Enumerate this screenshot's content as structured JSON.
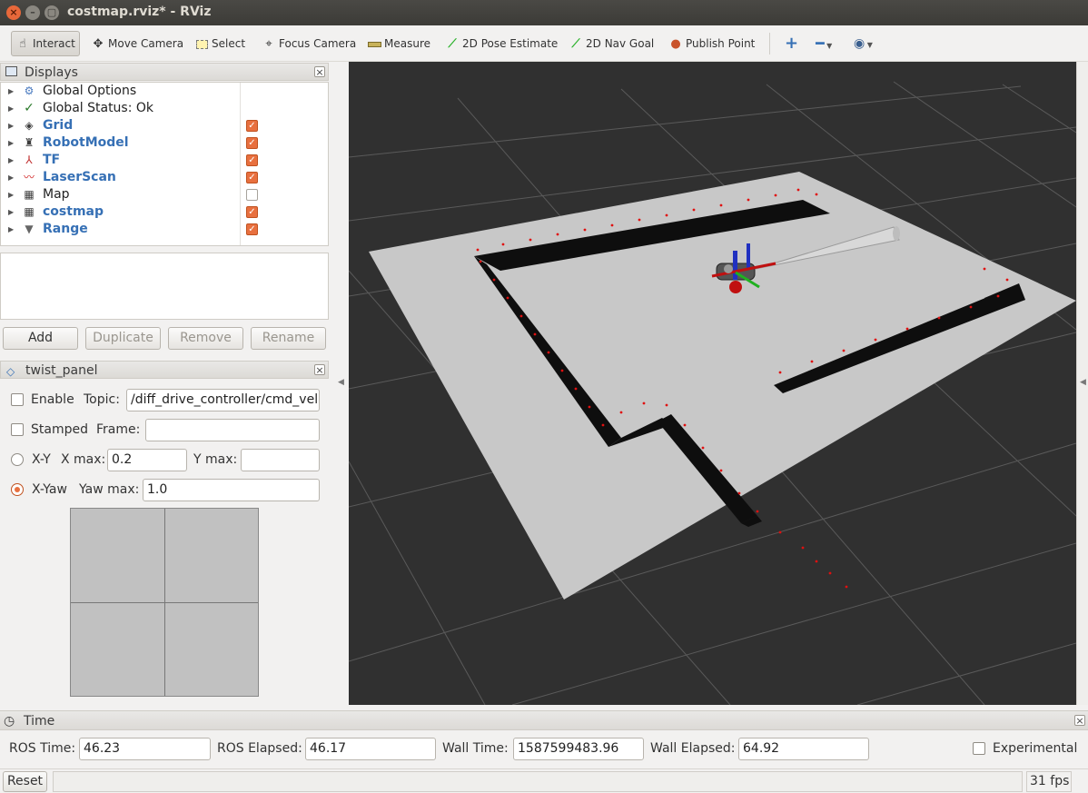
{
  "window": {
    "title": "costmap.rviz* - RViz"
  },
  "toolbar": {
    "tools": [
      {
        "label": "Interact",
        "icon": "hand-pointer-icon"
      },
      {
        "label": "Move Camera",
        "icon": "move-arrows-icon"
      },
      {
        "label": "Select",
        "icon": "selection-box-icon"
      },
      {
        "label": "Focus Camera",
        "icon": "crosshair-icon"
      },
      {
        "label": "Measure",
        "icon": "ruler-icon"
      },
      {
        "label": "2D Pose Estimate",
        "icon": "green-arrow-icon"
      },
      {
        "label": "2D Nav Goal",
        "icon": "green-arrow-icon"
      },
      {
        "label": "Publish Point",
        "icon": "map-pin-icon"
      }
    ]
  },
  "displays": {
    "title": "Displays",
    "items": [
      {
        "label": "Global Options",
        "icon": "gear-icon",
        "checked": null
      },
      {
        "label": "Global Status: Ok",
        "icon": "checkmark-icon",
        "checked": null
      },
      {
        "label": "Grid",
        "icon": "grid-icon",
        "checked": true
      },
      {
        "label": "RobotModel",
        "icon": "robot-icon",
        "checked": true
      },
      {
        "label": "TF",
        "icon": "axes-icon",
        "checked": true
      },
      {
        "label": "LaserScan",
        "icon": "laser-icon",
        "checked": true
      },
      {
        "label": "Map",
        "icon": "map-icon",
        "checked": false
      },
      {
        "label": "costmap",
        "icon": "map-icon",
        "checked": true
      },
      {
        "label": "Range",
        "icon": "cone-icon",
        "checked": true
      }
    ],
    "buttons": {
      "add": "Add",
      "duplicate": "Duplicate",
      "remove": "Remove",
      "rename": "Rename"
    }
  },
  "twist_panel": {
    "title": "twist_panel",
    "enable_label": "Enable",
    "topic_label": "Topic:",
    "topic_value": "/diff_drive_controller/cmd_vel",
    "stamped_label": "Stamped",
    "frame_label": "Frame:",
    "frame_value": "",
    "xy_label": "X-Y",
    "xmax_label": "X max:",
    "xmax_value": "0.2",
    "ymax_label": "Y max:",
    "ymax_value": "",
    "xyaw_label": "X-Yaw",
    "yawmax_label": "Yaw max:",
    "yawmax_value": "1.0"
  },
  "time": {
    "title": "Time",
    "ros_time_label": "ROS Time:",
    "ros_time": "46.23",
    "ros_elapsed_label": "ROS Elapsed:",
    "ros_elapsed": "46.17",
    "wall_time_label": "Wall Time:",
    "wall_time": "1587599483.96",
    "wall_elapsed_label": "Wall Elapsed:",
    "wall_elapsed": "64.92",
    "experimental_label": "Experimental"
  },
  "status": {
    "reset_label": "Reset",
    "fps": "31 fps"
  },
  "colors": {
    "accent": "#e8703f",
    "link_blue": "#3670b5",
    "viewport_bg": "#303030"
  }
}
